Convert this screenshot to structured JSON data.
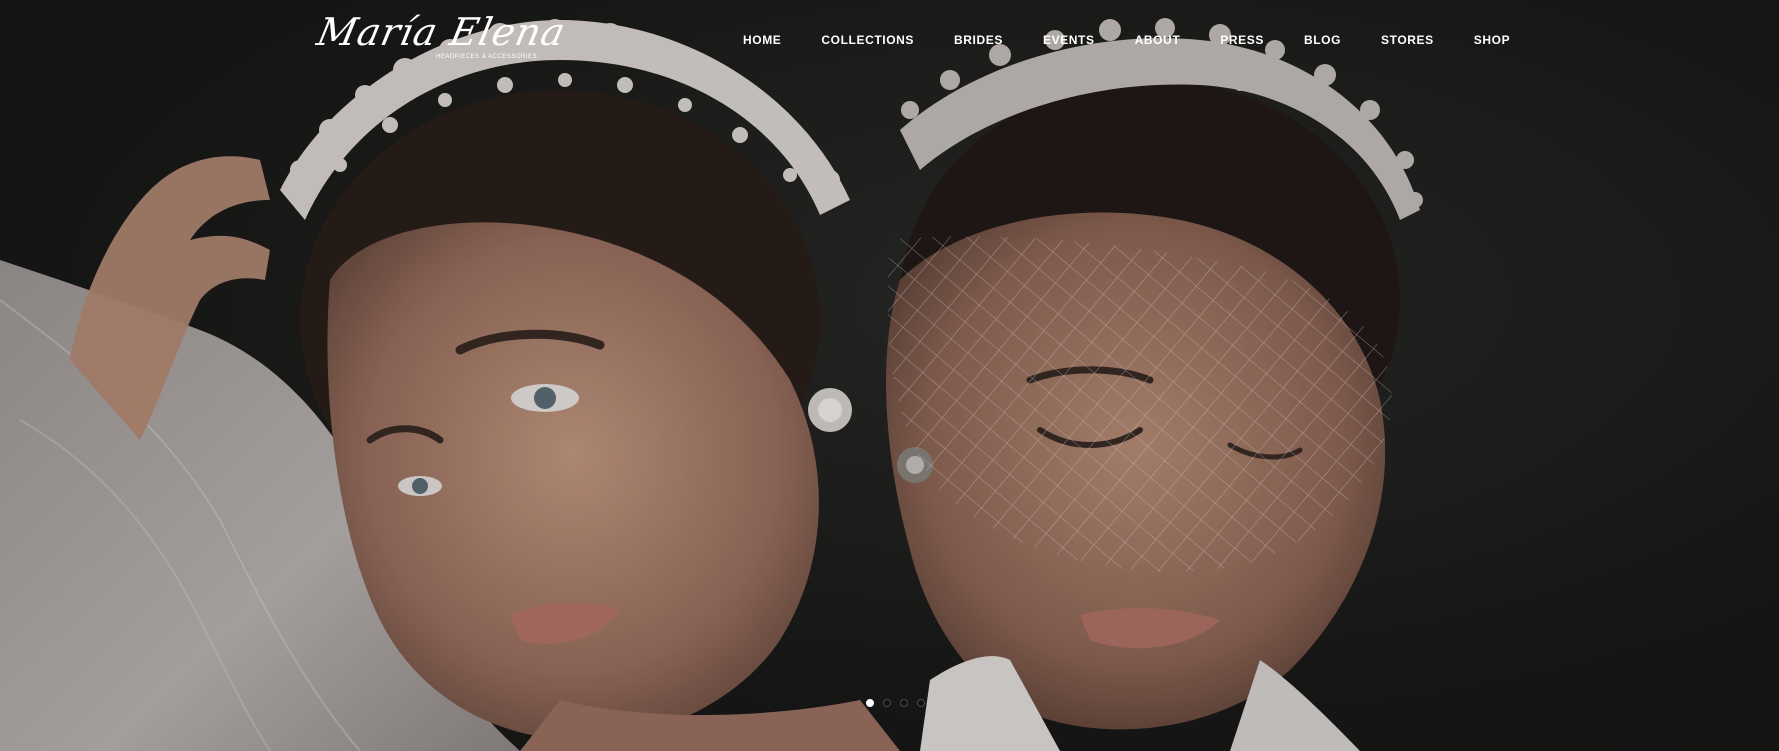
{
  "brand": {
    "logo_script": "María Elena",
    "logo_tagline": "HEADPIECES & ACCESSORIES"
  },
  "nav": {
    "items": [
      {
        "label": "HOME"
      },
      {
        "label": "COLLECTIONS"
      },
      {
        "label": "BRIDES"
      },
      {
        "label": "EVENTS"
      },
      {
        "label": "ABOUT"
      },
      {
        "label": "PRESS"
      },
      {
        "label": "BLOG"
      },
      {
        "label": "STORES"
      },
      {
        "label": "SHOP"
      }
    ]
  },
  "slider": {
    "slide_count": 4,
    "active_index": 0
  },
  "colors": {
    "background": "#1c1c1b",
    "nav_text": "#ffffff",
    "dot_active": "#ffffff",
    "dot_inactive": "#111111"
  }
}
